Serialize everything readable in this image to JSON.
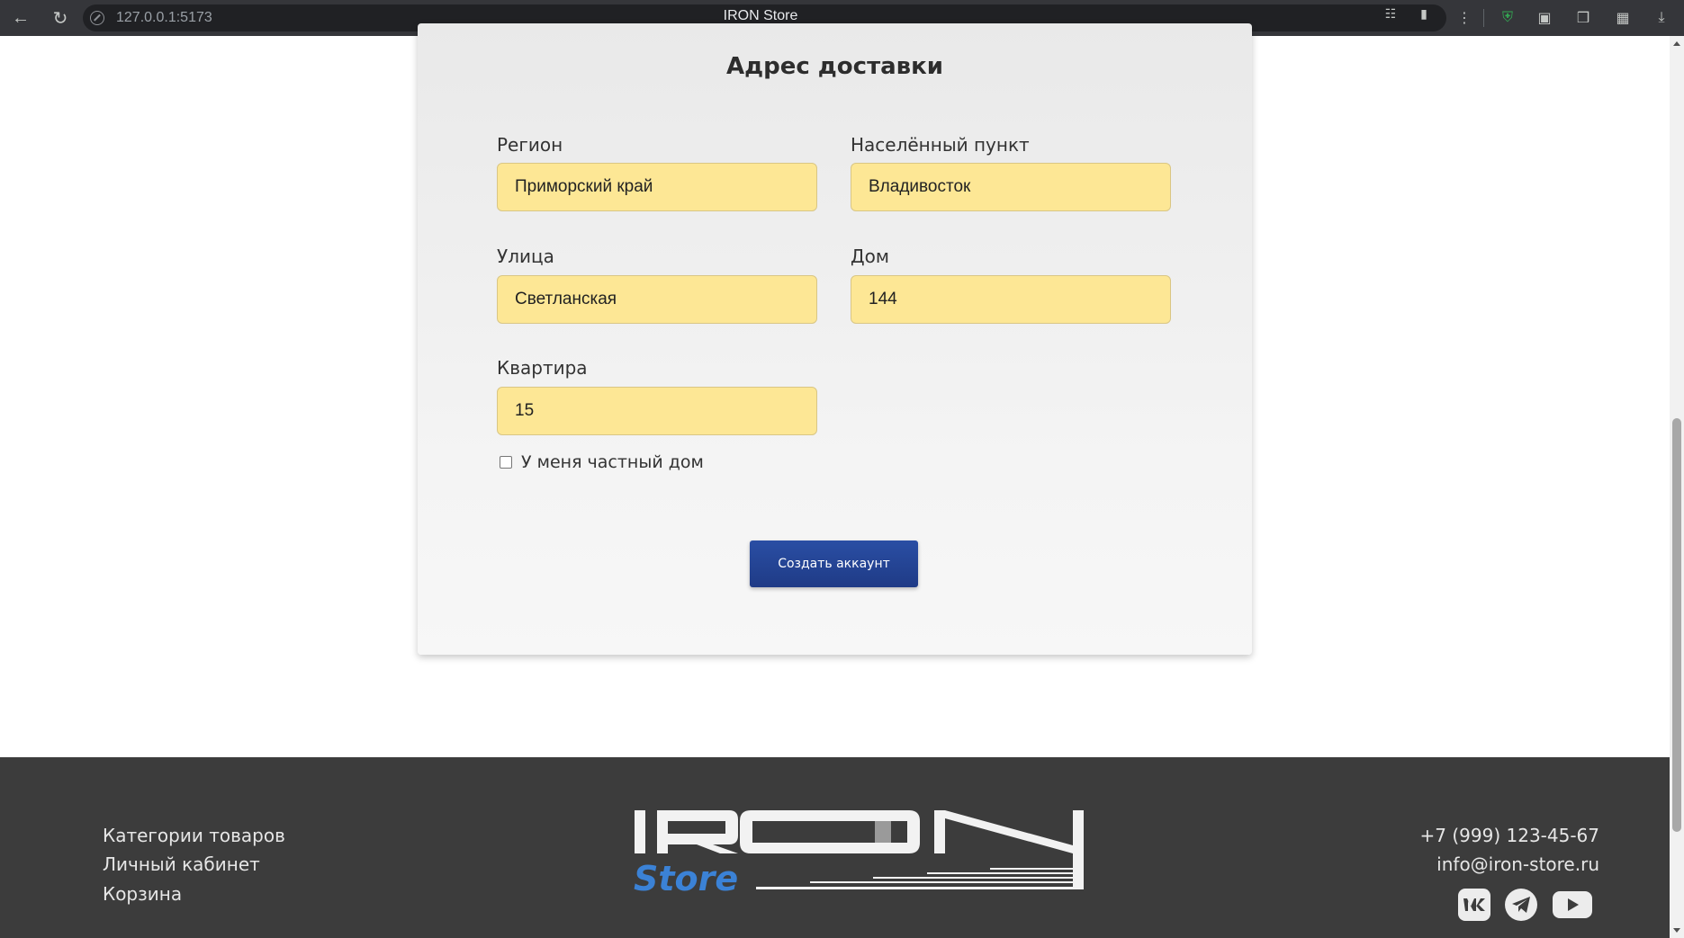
{
  "browser": {
    "url": "127.0.0.1:5173",
    "tab_title": "IRON Store"
  },
  "form": {
    "title": "Адрес доставки",
    "fields": {
      "region": {
        "label": "Регион",
        "value": "Приморский край"
      },
      "city": {
        "label": "Населённый пункт",
        "value": "Владивосток"
      },
      "street": {
        "label": "Улица",
        "value": "Светланская"
      },
      "house": {
        "label": "Дом",
        "value": "144"
      },
      "apartment": {
        "label": "Квартира",
        "value": "15"
      }
    },
    "private_house_checkbox": {
      "label": "У меня частный дом",
      "checked": false
    },
    "submit_label": "Создать аккаунт",
    "field_color": "#fde795",
    "button_color": "#2a4ea4"
  },
  "footer": {
    "links": [
      "Категории товаров",
      "Личный кабинет",
      "Корзина"
    ],
    "phone": "+7 (999) 123-45-67",
    "email": "info@iron-store.ru",
    "logo": {
      "wordmark": "IRON",
      "subtitle": "Store",
      "accent": "#3b82d6"
    },
    "social": [
      "vk-icon",
      "telegram-icon",
      "youtube-icon"
    ]
  }
}
